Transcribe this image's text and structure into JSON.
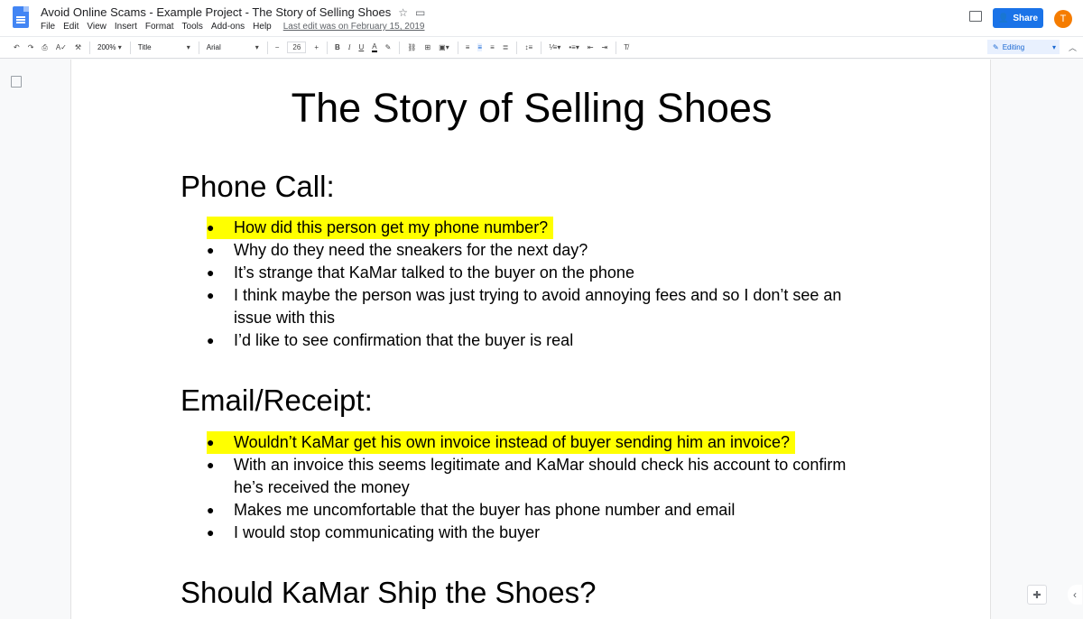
{
  "app": {
    "doc_title": "Avoid Online Scams - Example Project - The Story of Selling Shoes",
    "menus": [
      "File",
      "Edit",
      "View",
      "Insert",
      "Format",
      "Tools",
      "Add-ons",
      "Help"
    ],
    "last_edit": "Last edit was on February 15, 2019",
    "share_label": "Share",
    "avatar_letter": "T"
  },
  "toolbar": {
    "zoom": "200%",
    "style": "Title",
    "font": "Arial",
    "font_size": "26",
    "mode": "Editing",
    "icons": [
      "undo-icon",
      "redo-icon",
      "print-icon",
      "spellcheck-icon",
      "paint-format-icon",
      "bold-icon",
      "italic-icon",
      "underline-icon",
      "text-color-icon",
      "highlight-icon",
      "link-icon",
      "comment-icon",
      "image-icon",
      "align-left-icon",
      "align-center-icon",
      "align-right-icon",
      "justify-icon",
      "line-spacing-icon",
      "numbered-list-icon",
      "bulleted-list-icon",
      "decrease-indent-icon",
      "increase-indent-icon",
      "clear-formatting-icon"
    ]
  },
  "document": {
    "title": "The Story of Selling Shoes",
    "sections": [
      {
        "heading": "Phone Call:",
        "bullets": [
          "How did this person get my phone number?",
          "Why do they need the sneakers for the next day?",
          "It’s strange that KaMar talked to the buyer on the phone",
          "I think maybe the person was just trying to avoid annoying fees and so I don’t see an issue with this",
          "I’d like to see confirmation that the buyer is real"
        ]
      },
      {
        "heading": "Email/Receipt:",
        "bullets": [
          "Wouldn’t KaMar get his own invoice instead of buyer sending him an invoice?",
          "With an invoice this seems legitimate and KaMar should check his account to confirm he’s received the money",
          "Makes me uncomfortable that the buyer has phone number and email",
          "I would stop communicating with the buyer"
        ]
      },
      {
        "heading": "Should KaMar Ship the Shoes?"
      }
    ]
  }
}
